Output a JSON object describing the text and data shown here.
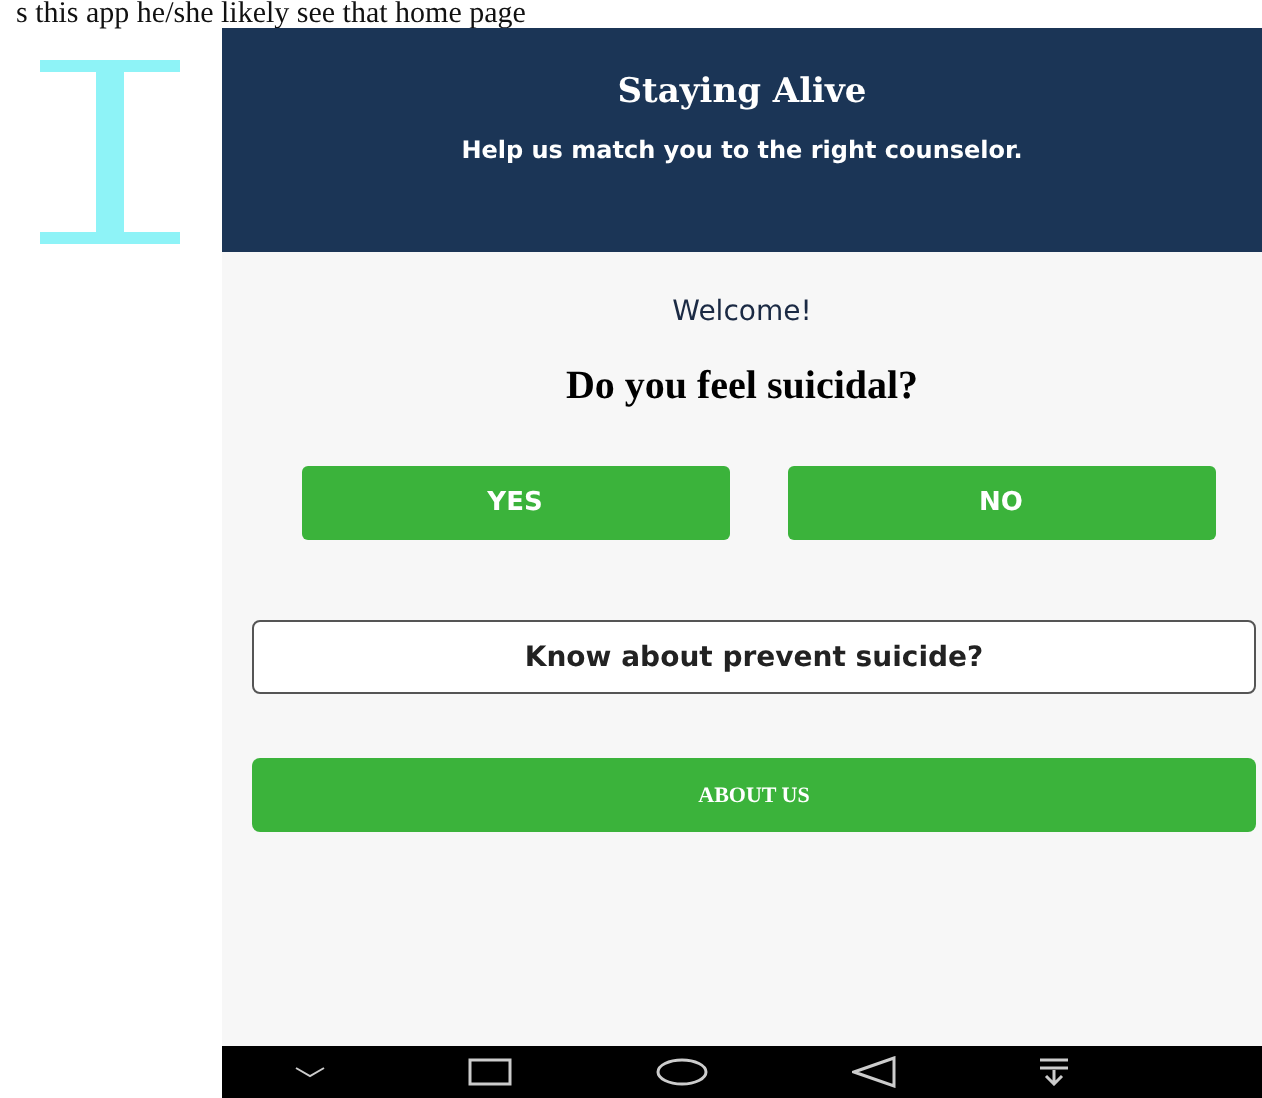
{
  "caption": "s this app he/she likely see that home page",
  "header": {
    "title": "Staying Alive",
    "subtitle": "Help us match you to the right counselor."
  },
  "welcome": "Welcome!",
  "question": "Do you feel suicidal?",
  "answer_buttons": [
    "YES",
    "NO"
  ],
  "info_button": "Know about prevent suicide?",
  "about_button": "ABOUT US"
}
